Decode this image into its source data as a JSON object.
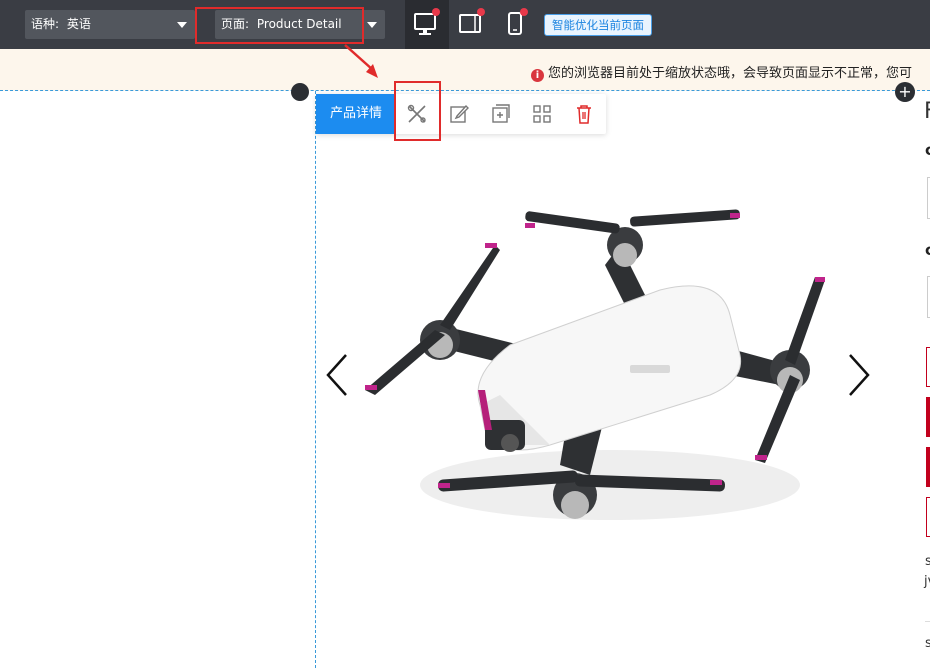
{
  "header": {
    "language_select": {
      "label": "语种:",
      "value": "英语"
    },
    "page_select": {
      "label": "页面:",
      "value": "Product Detail"
    },
    "smart_optimize_button": "智能优化当前页面"
  },
  "notice": {
    "text": "您的浏览器目前处于缩放状态哦，会导致页面显示不正常，您可"
  },
  "module_toolbar": {
    "label": "产品详情"
  },
  "right_panel_fragments": [
    "F",
    "c",
    "c",
    "s",
    "jv",
    "s"
  ],
  "colors": {
    "accent": "#1c8cf0",
    "danger": "#e02b2b",
    "topbar": "#3a3d44"
  },
  "icons": [
    "desktop-icon",
    "tablet-icon",
    "mobile-icon",
    "tools-icon",
    "edit-icon",
    "add-copy-icon",
    "grid-icon",
    "trash-icon",
    "chevron-left-icon",
    "chevron-right-icon",
    "info-icon"
  ]
}
